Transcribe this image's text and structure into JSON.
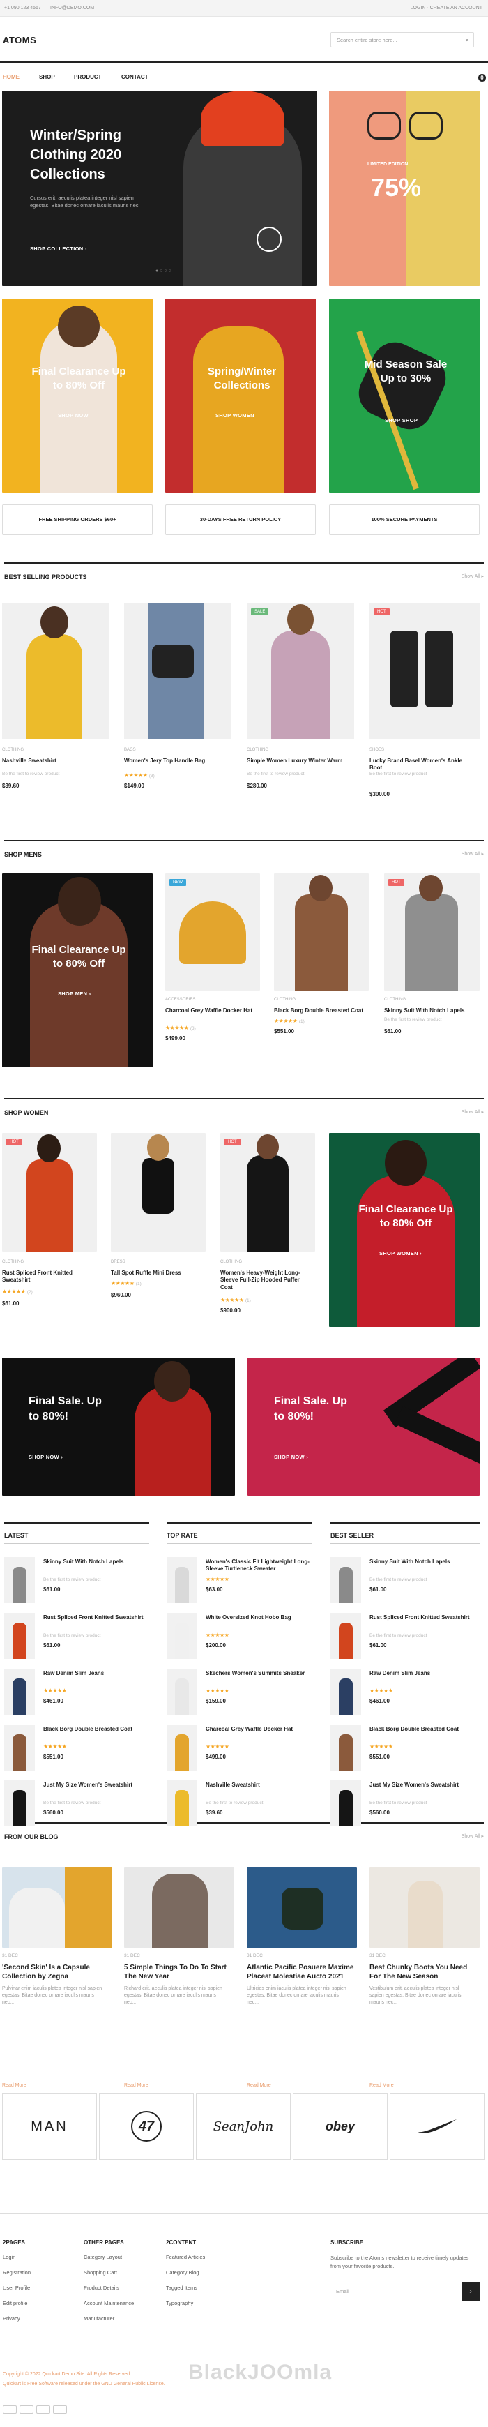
{
  "topbar": {
    "phone": "+1 090 123 4567",
    "email": "INFO@DEMO.COM",
    "account": "LOGIN · CREATE AN ACCOUNT"
  },
  "header": {
    "logo": "ATOMS",
    "search_placeholder": "Search entire store here...",
    "cart_count": "0"
  },
  "nav": [
    "Home",
    "Shop",
    "Product",
    "Contact"
  ],
  "hero": {
    "title_lines": [
      "Winter/Spring",
      "Clothing 2020",
      "Collections"
    ],
    "text": "Cursus erit, aeculis platea integer nisl sapien egestas. Bitae donec ornare iaculis mauris nec.",
    "cta": "SHOP COLLECTION",
    "side_text": "75%",
    "side_small": "LIMITED EDITION"
  },
  "promos": [
    {
      "title": "Final Clearance Up to 80% Off",
      "cta": "SHOP NOW"
    },
    {
      "title": "Spring/Winter Collections",
      "cta": "SHOP WOMEN"
    },
    {
      "title": "Mid Season Sale Up to 30%",
      "cta": "SHOP SHOP"
    }
  ],
  "features": [
    "FREE SHIPPING ORDERS $60+",
    "30-DAYS FREE RETURN POLICY",
    "100% SECURE PAYMENTS"
  ],
  "best_selling": {
    "title": "BEST SELLING PRODUCTS",
    "view_all": "Show All ▸",
    "items": [
      {
        "cat": "CLOTHING",
        "name": "Nashville Sweatshirt",
        "rating": "",
        "review": "Be the first to review product",
        "price": "$39.60",
        "badge": "",
        "color": "#ecbb2b"
      },
      {
        "cat": "BAGS",
        "name": "Women's Jery Top Handle Bag",
        "rating": "★★★★★",
        "review": "(3)",
        "price": "$149.00",
        "badge": "",
        "color": "#222"
      },
      {
        "cat": "CLOTHING",
        "name": "Simple Women Luxury Winter Warm",
        "rating": "",
        "review": "Be the first to review product",
        "price": "$280.00",
        "badge": "SALE",
        "color": "#c6a2b7"
      },
      {
        "cat": "SHOES",
        "name": "Lucky Brand Basel Women's Ankle Boot",
        "rating": "",
        "review": "Be the first to review product",
        "price": "$300.00",
        "badge": "HOT",
        "color": "#222"
      }
    ]
  },
  "shop_mens": {
    "title": "SHOP MENS",
    "view_all": "Show All ▸",
    "banner_title": "Final Clearance Up to 80% Off",
    "banner_cta": "SHOP MEN",
    "items": [
      {
        "cat": "ACCESSORIES",
        "name": "Charcoal Grey Waffle Docker Hat",
        "rating": "★★★★★",
        "review": "(3)",
        "price": "$499.00",
        "badge": "NEW"
      },
      {
        "cat": "CLOTHING",
        "name": "Black Borg Double Breasted Coat",
        "rating": "★★★★★",
        "review": "(1)",
        "price": "$551.00",
        "badge": ""
      },
      {
        "cat": "CLOTHING",
        "name": "Skinny Suit With Notch Lapels",
        "rating": "",
        "review": "Be the first to review product",
        "price": "$61.00",
        "badge": "HOT"
      }
    ]
  },
  "shop_women": {
    "title": "SHOP WOMEN",
    "view_all": "Show All ▸",
    "banner_title": "Final Clearance Up to 80% Off",
    "banner_cta": "SHOP WOMEN",
    "items": [
      {
        "cat": "CLOTHING",
        "name": "Rust Spliced Front Knitted Sweatshirt",
        "rating": "★★★★★",
        "review": "(2)",
        "price": "$61.00",
        "badge": "HOT"
      },
      {
        "cat": "DRESS",
        "name": "Tall Spot Ruffle Mini Dress",
        "rating": "★★★★★",
        "review": "(1)",
        "price": "$960.00",
        "badge": ""
      },
      {
        "cat": "CLOTHING",
        "name": "Women's Heavy-Weight Long-Sleeve Full-Zip Hooded Puffer Coat",
        "rating": "★★★★★",
        "review": "(1)",
        "price": "$900.00",
        "badge": "HOT"
      }
    ]
  },
  "sale_banners": [
    {
      "title": "Final Sale. Up to 80%!",
      "cta": "SHOP NOW"
    },
    {
      "title": "Final Sale. Up to 80%!",
      "cta": "SHOP NOW"
    }
  ],
  "lists": [
    {
      "title": "LATEST",
      "items": [
        {
          "name": "Skinny Suit With Notch Lapels",
          "rating": "",
          "review": "Be the first to review product",
          "price": "$61.00"
        },
        {
          "name": "Rust Spliced Front Knitted Sweatshirt",
          "rating": "",
          "review": "Be the first to review product",
          "price": "$61.00"
        },
        {
          "name": "Raw Denim Slim Jeans",
          "rating": "★★★★★",
          "review": "",
          "price": "$461.00"
        },
        {
          "name": "Black Borg Double Breasted Coat",
          "rating": "★★★★★",
          "review": "",
          "price": "$551.00"
        },
        {
          "name": "Just My Size Women's Sweatshirt",
          "rating": "",
          "review": "Be the first to review product",
          "price": "$560.00"
        }
      ]
    },
    {
      "title": "TOP RATE",
      "items": [
        {
          "name": "Women's Classic Fit Lightweight Long-Sleeve Turtleneck Sweater",
          "rating": "★★★★★",
          "review": "",
          "price": "$63.00"
        },
        {
          "name": "White Oversized Knot Hobo Bag",
          "rating": "★★★★★",
          "review": "",
          "price": "$200.00"
        },
        {
          "name": "Skechers Women's Summits Sneaker",
          "rating": "★★★★★",
          "review": "",
          "price": "$159.00"
        },
        {
          "name": "Charcoal Grey Waffle Docker Hat",
          "rating": "★★★★★",
          "review": "",
          "price": "$499.00"
        },
        {
          "name": "Nashville Sweatshirt",
          "rating": "",
          "review": "Be the first to review product",
          "price": "$39.60"
        }
      ]
    },
    {
      "title": "BEST SELLER",
      "items": [
        {
          "name": "Skinny Suit With Notch Lapels",
          "rating": "",
          "review": "Be the first to review product",
          "price": "$61.00"
        },
        {
          "name": "Rust Spliced Front Knitted Sweatshirt",
          "rating": "",
          "review": "Be the first to review product",
          "price": "$61.00"
        },
        {
          "name": "Raw Denim Slim Jeans",
          "rating": "★★★★★",
          "review": "",
          "price": "$461.00"
        },
        {
          "name": "Black Borg Double Breasted Coat",
          "rating": "★★★★★",
          "review": "",
          "price": "$551.00"
        },
        {
          "name": "Just My Size Women's Sweatshirt",
          "rating": "",
          "review": "Be the first to review product",
          "price": "$560.00"
        }
      ]
    }
  ],
  "blog": {
    "title": "FROM OUR BLOG",
    "view_all": "Show All ▸",
    "posts": [
      {
        "date": "31 DEC",
        "title": "'Second Skin' Is a Capsule Collection by Zegna",
        "excerpt": "Pulvinar enim iaculis platea integer nisl sapien egestas. Bitae donec ornare iaculis mauris nec...",
        "more": "Read More"
      },
      {
        "date": "31 DEC",
        "title": "5 Simple Things To Do To Start The New Year",
        "excerpt": "Richard erit, aeculis platea integer nisl sapien egestas. Bitae donec ornare iaculis mauris nec...",
        "more": "Read More"
      },
      {
        "date": "31 DEC",
        "title": "Atlantic Pacific Posuere Maxime Placeat Molestiae Aucto 2021",
        "excerpt": "Ultricies enim iaculis platea integer nisl sapien egestas. Bitae donec ornare iaculis mauris nec...",
        "more": "Read More"
      },
      {
        "date": "31 DEC",
        "title": "Best Chunky Boots You Need For The New Season",
        "excerpt": "Vestibulum erit, aeculis platea integer nisl sapien egestas. Bitae donec ornare iaculis mauris nec...",
        "more": "Read More"
      }
    ]
  },
  "brands": [
    "MAN",
    "47",
    "SeanJohn",
    "obey",
    "swoosh"
  ],
  "footer": {
    "cols": [
      {
        "title": "2PAGES",
        "links": [
          "Login",
          "Registration",
          "User Profile",
          "Edit profile",
          "Privacy"
        ]
      },
      {
        "title": "OTHER PAGES",
        "links": [
          "Category Layout",
          "Shopping Cart",
          "Product Details",
          "Account Maintenance",
          "Manufacturer"
        ]
      },
      {
        "title": "2CONTENT",
        "links": [
          "Featured Articles",
          "Category Blog",
          "Tagged Items",
          "Typography"
        ]
      }
    ],
    "subscribe_title": "SUBSCRIBE",
    "subscribe_text": "Subscribe to the Atoms newsletter to receive timely updates from your favorite products.",
    "email_placeholder": "Email",
    "copyright": "Copyright © 2022 Quickart Demo Site. All Rights Reserved.",
    "license": "Quickart is Free Software released under the GNU General Public License.",
    "watermark": "BlackJOOmla"
  }
}
